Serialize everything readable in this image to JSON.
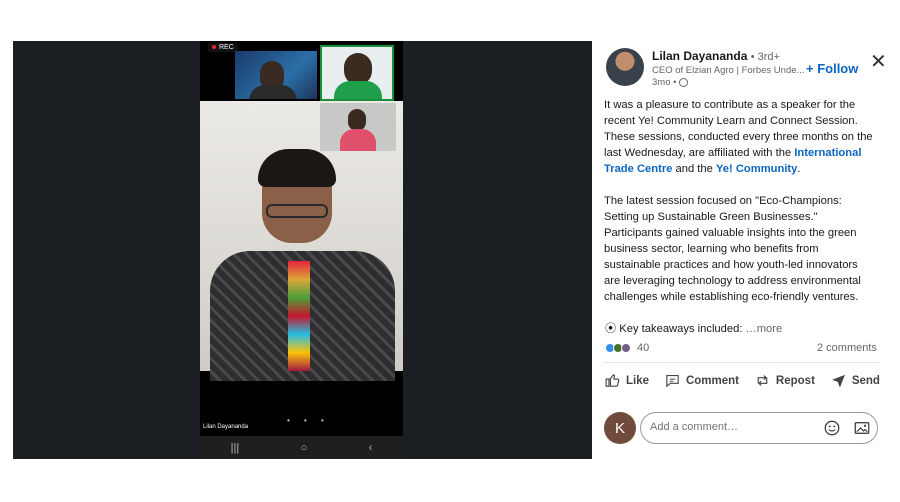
{
  "video": {
    "rec_label": "REC",
    "main_participant": "Lilan Dayananda",
    "nav": [
      "|||",
      "○",
      "‹"
    ]
  },
  "author": {
    "name": "Lilan Dayananda",
    "degree": "• 3rd+",
    "headline": "CEO of Elzian Agro | Forbes Unde...",
    "time": "3mo •",
    "follow_label": "+ Follow"
  },
  "post": {
    "p1_a": "It was a pleasure to contribute as a speaker for the recent Ye! Community Learn and Connect Session. These sessions, conducted every three months on the last Wednesday, are affiliated with the ",
    "p1_link1": "International Trade Centre",
    "p1_b": " and the ",
    "p1_link2": "Ye! Community",
    "p1_c": ".",
    "p2": "The latest session focused on \"Eco-Champions: Setting up Sustainable Green Businesses.\" Participants gained valuable insights into the green business sector, learning who benefits from sustainable practices and how youth-led innovators are leveraging technology to address environmental challenges while establishing eco-friendly ventures.",
    "takeaways": "⦿ Key takeaways included:",
    "more": "…more"
  },
  "social": {
    "reaction_count": "40",
    "comments": "2 comments"
  },
  "actions": {
    "like": "Like",
    "comment": "Comment",
    "repost": "Repost",
    "send": "Send"
  },
  "comment_box": {
    "avatar_letter": "K",
    "placeholder": "Add a comment…"
  },
  "colors": {
    "brand": "#0a66c2",
    "panel_bg": "#ffffff",
    "media_bg": "#1b1f23"
  }
}
